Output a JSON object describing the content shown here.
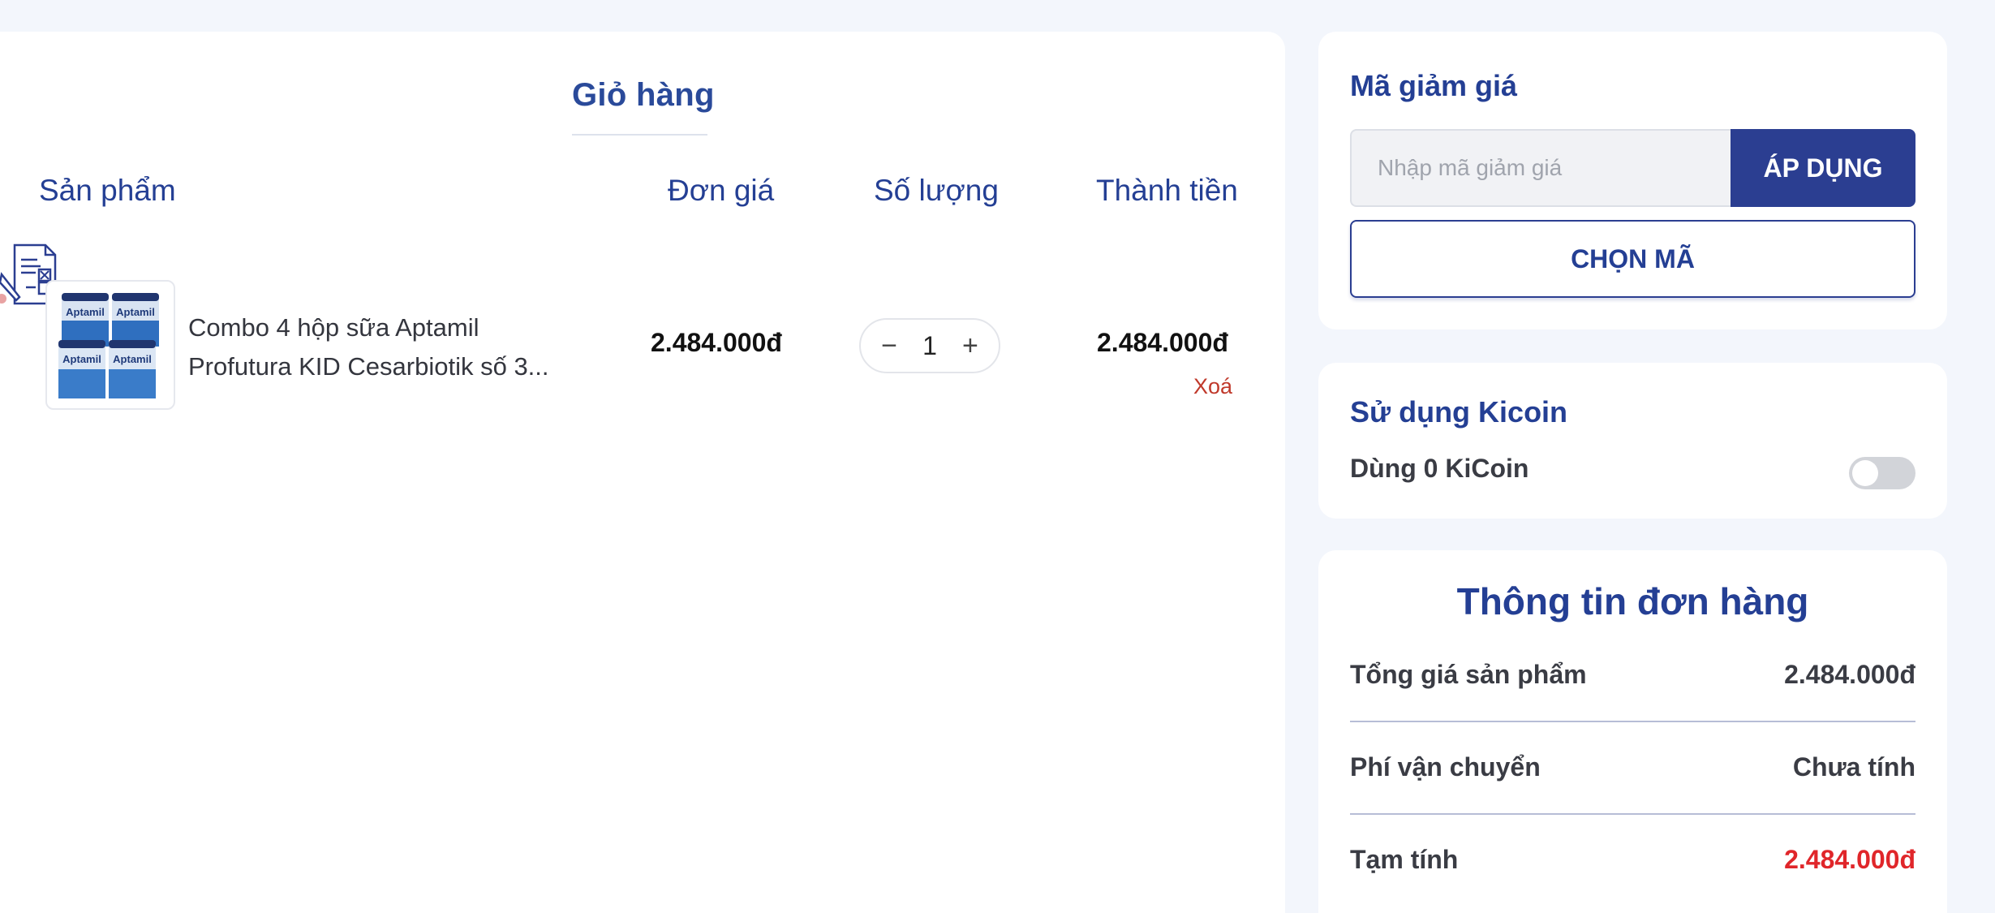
{
  "cart": {
    "title": "Giỏ hàng",
    "columns": {
      "product": "Sản phẩm",
      "unit_price": "Đơn giá",
      "quantity": "Số lượng",
      "total": "Thành tiền"
    },
    "items": [
      {
        "name_line1": "Combo 4 hộp sữa Aptamil",
        "name_line2": "Profutura KID Cesarbiotik số 3...",
        "unit_price": "2.484.000đ",
        "quantity": "1",
        "line_total": "2.484.000đ",
        "delete_label": "Xoá",
        "thumb_brand": "Aptamil"
      }
    ],
    "qty_minus": "−",
    "qty_plus": "+"
  },
  "discount": {
    "heading": "Mã giảm giá",
    "placeholder": "Nhập mã giảm giá",
    "apply_label": "ÁP DỤNG",
    "choose_label": "CHỌN MÃ"
  },
  "kicoin": {
    "heading": "Sử dụng Kicoin",
    "usage_text": "Dùng  0  KiCoin",
    "enabled": false
  },
  "order_info": {
    "title": "Thông tin đơn hàng",
    "rows": [
      {
        "label": "Tổng giá sản phẩm",
        "value": "2.484.000đ"
      },
      {
        "label": "Phí vận chuyển",
        "value": "Chưa tính"
      },
      {
        "label": "Tạm tính",
        "value": "2.484.000đ"
      }
    ]
  },
  "colors": {
    "primary": "#2b3e91",
    "heading": "#243f94",
    "danger": "#e0262a",
    "background": "#f3f6fc"
  }
}
